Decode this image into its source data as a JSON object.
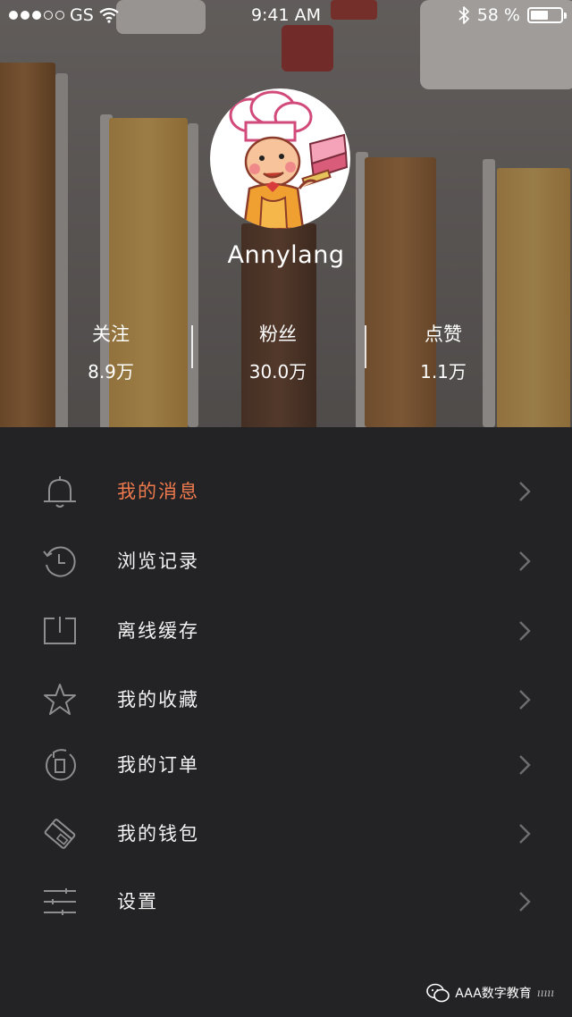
{
  "status_bar": {
    "carrier": "GS",
    "time": "9:41 AM",
    "battery_text": "58 %",
    "battery_level": 0.58
  },
  "profile": {
    "username": "Annylang",
    "stats": [
      {
        "label": "关注",
        "value": "8.9万"
      },
      {
        "label": "粉丝",
        "value": "30.0万"
      },
      {
        "label": "点赞",
        "value": "1.1万"
      }
    ]
  },
  "menu": {
    "items": [
      {
        "label": "我的消息",
        "icon": "bell-icon",
        "active": true
      },
      {
        "label": "浏览记录",
        "icon": "history-icon",
        "active": false
      },
      {
        "label": "离线缓存",
        "icon": "download-icon",
        "active": false
      },
      {
        "label": "我的收藏",
        "icon": "star-icon",
        "active": false
      },
      {
        "label": "我的订单",
        "icon": "order-icon",
        "active": false
      },
      {
        "label": "我的钱包",
        "icon": "wallet-icon",
        "active": false
      },
      {
        "label": "设置",
        "icon": "settings-icon",
        "active": false
      }
    ]
  },
  "watermark": {
    "text": "AAA数字教育"
  },
  "colors": {
    "accent": "#ee7a4e",
    "menu_bg": "#232325",
    "icon_gray": "#8e8e90",
    "chevron_gray": "#6e6e70"
  }
}
